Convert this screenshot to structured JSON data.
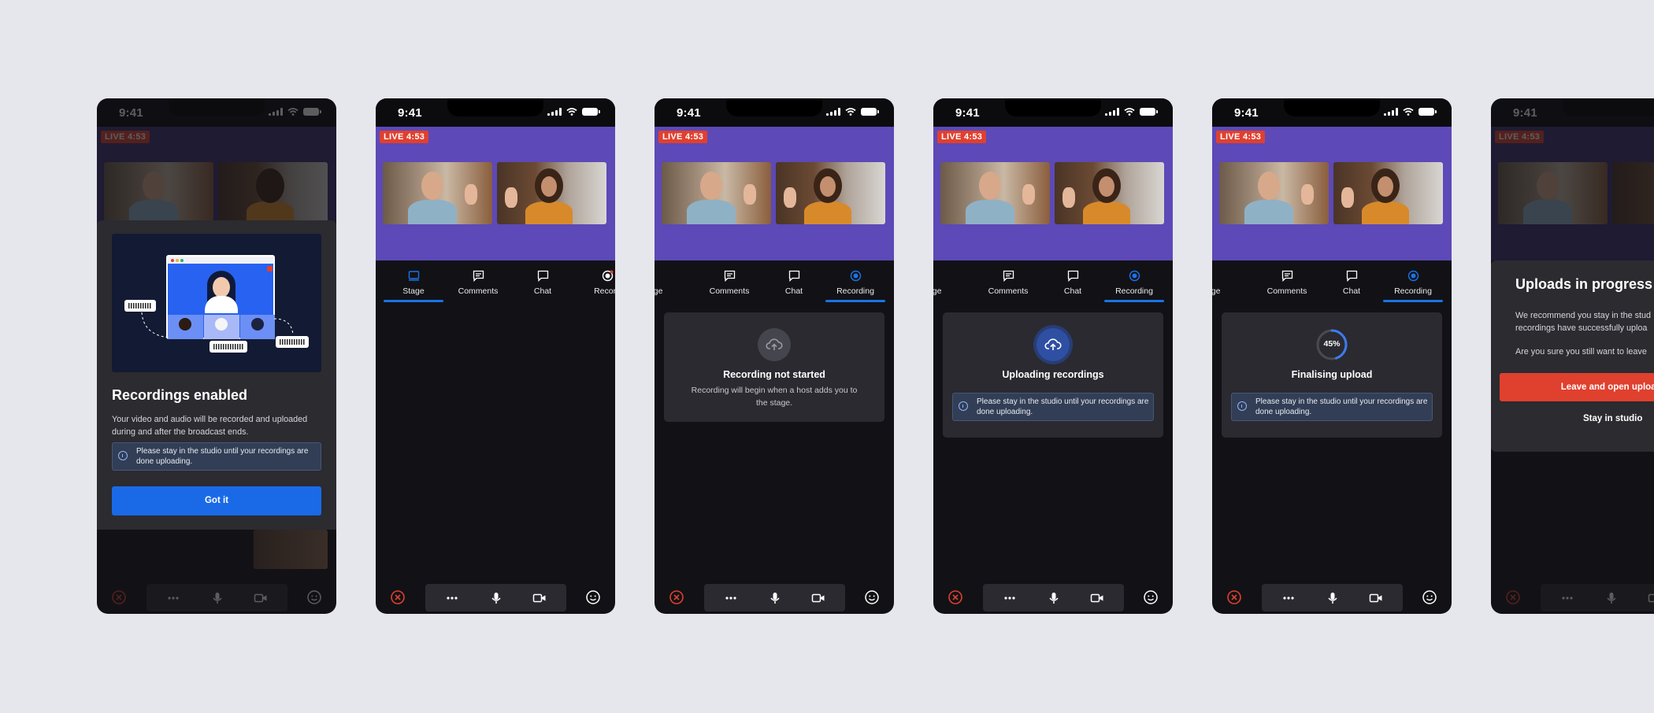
{
  "status": {
    "time": "9:41"
  },
  "stage": {
    "live_label": "LIVE 4:53"
  },
  "tabs": {
    "stage": "Stage",
    "comments": "Comments",
    "chat": "Chat",
    "recording": "Recording",
    "recording_cut": "Record",
    "stage_cut": "tage"
  },
  "screen1": {
    "title": "Recordings enabled",
    "body": "Your video and audio will be recorded and uploaded during and after the broadcast ends.",
    "info": "Please stay in the studio until your recordings are done uploading.",
    "button": "Got it"
  },
  "screen3": {
    "title": "Recording not started",
    "subtitle": "Recording will begin when a host adds you to the stage."
  },
  "screen4": {
    "title": "Uploading recordings",
    "info": "Please stay in the studio until your recordings are done uploading."
  },
  "screen5": {
    "title": "Finalising upload",
    "progress_label": "45%",
    "progress_value": 0.45,
    "info": "Please stay in the studio until your recordings are done uploading."
  },
  "screen6": {
    "title": "Uploads in progress",
    "body1": "We recommend you stay in the stud",
    "body1b": "recordings have successfully uploa",
    "body2": "Are you sure you still want to leave",
    "leave_button": "Leave and open uploads p",
    "stay_button": "Stay in studio"
  },
  "colors": {
    "background": "#e6e7ec",
    "stage_purple": "#5d49b7",
    "live_red": "#e0402e",
    "accent_blue": "#1a73e8",
    "card": "#2a2a30"
  }
}
